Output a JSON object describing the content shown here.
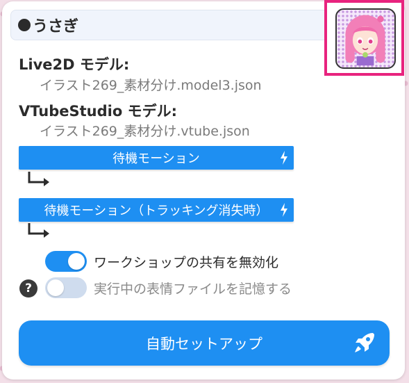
{
  "model": {
    "name": "うさぎ"
  },
  "live2d": {
    "heading": "Live2D モデル:",
    "file": "イラスト269_素材分け.model3.json"
  },
  "vtube": {
    "heading": "VTubeStudio モデル:",
    "file": "イラスト269_素材分け.vtube.json"
  },
  "motions": [
    {
      "label": "待機モーション",
      "icon": "lightning-icon"
    },
    {
      "label": "待機モーション（トラッキング消失時）",
      "icon": "lightning-icon"
    }
  ],
  "toggles": [
    {
      "label": "ワークショップの共有を無効化",
      "state": "on"
    },
    {
      "label": "実行中の表情ファイルを記憶する",
      "state": "off"
    }
  ],
  "help": {
    "symbol": "?"
  },
  "setup_button": {
    "label": "自動セットアップ",
    "icon": "rocket-icon"
  },
  "colors": {
    "accent": "#1e8ff2",
    "avatar_border": "#e8237e",
    "toggle_off": "#cfdcee"
  }
}
